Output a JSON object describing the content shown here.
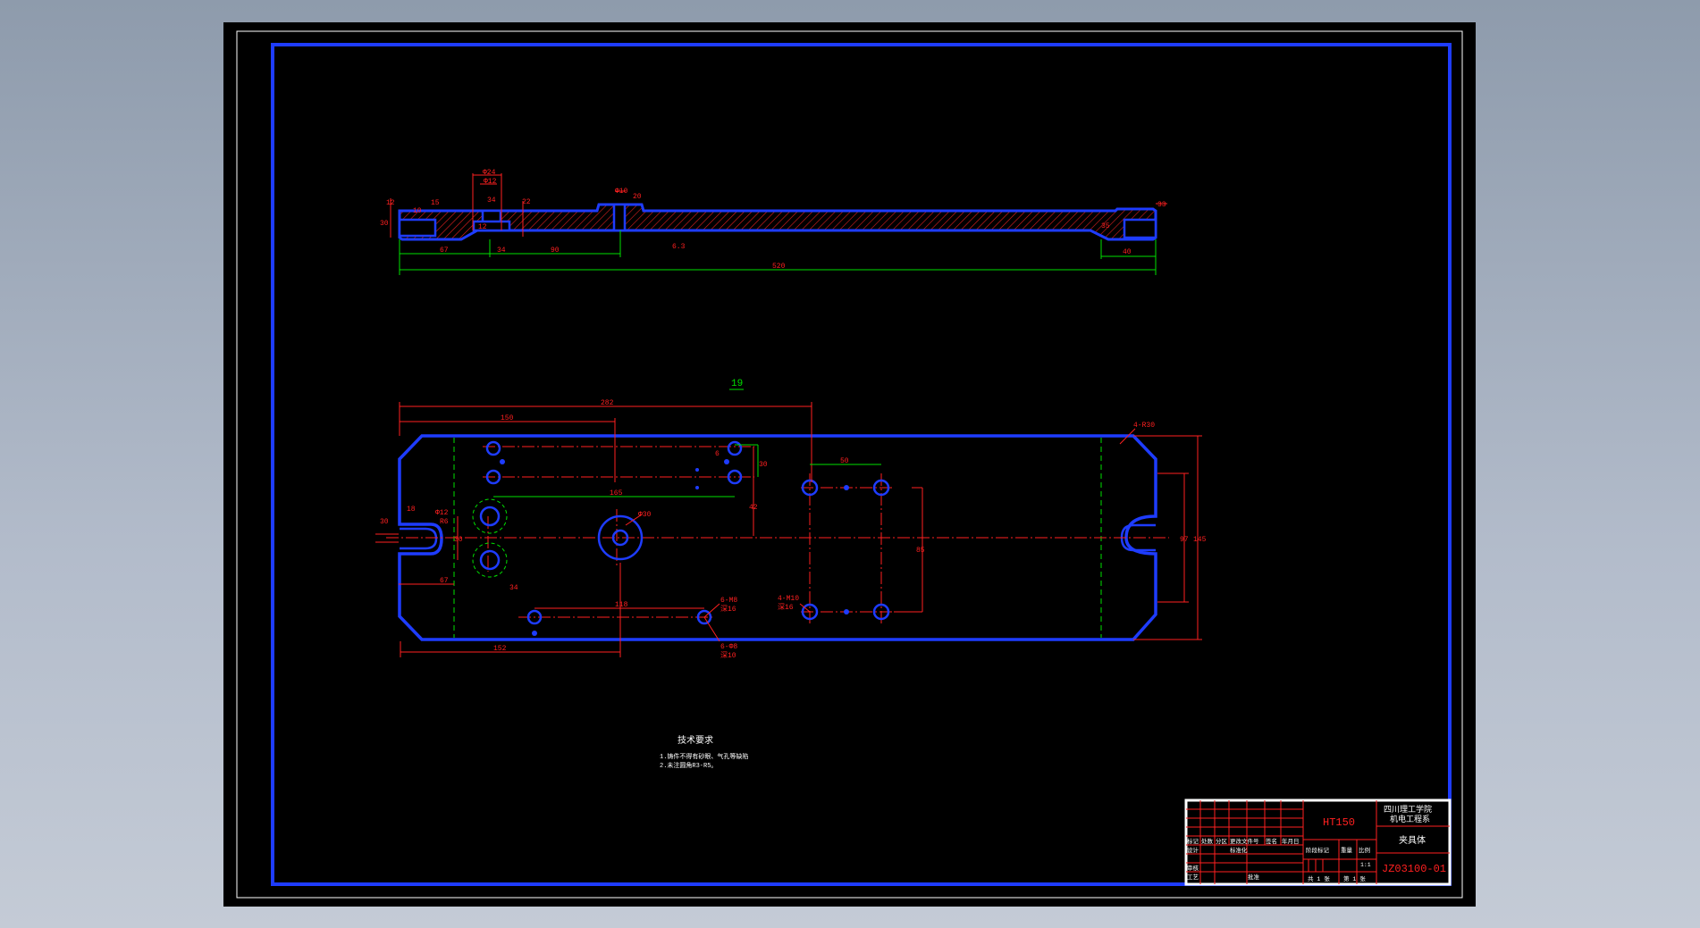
{
  "colors": {
    "background": "#9aa6b6",
    "paper": "#000000",
    "outline": "#1e3cff",
    "dimension": "#ff2020",
    "extension": "#00e000",
    "hatch": "#e02020",
    "frame": "#ffffff"
  },
  "section_view": {
    "dims_top": [
      "Φ24",
      "Φ12",
      "Φ10",
      "20",
      "34",
      "22",
      "33",
      "35"
    ],
    "dims_side": [
      "30",
      "12",
      "10",
      "15",
      "12"
    ],
    "dims_bottom": [
      "67",
      "34",
      "90",
      "40",
      "520"
    ],
    "roughness": "6.3"
  },
  "plan_view": {
    "datum_label": "19",
    "dims_top": [
      "282",
      "150",
      "50",
      "6",
      "30",
      "165"
    ],
    "dims_side": [
      "18",
      "Φ12",
      "R6",
      "30",
      "30",
      "67",
      "34",
      "42",
      "85",
      "97",
      "145"
    ],
    "dims_bottom": [
      "118",
      "152"
    ],
    "callouts": [
      "4-R30",
      "Φ30",
      "4-M10",
      "深16",
      "6-M8",
      "深16",
      "6-Φ8",
      "深10"
    ]
  },
  "notes": {
    "title": "技术要求",
    "lines": [
      "1.铸件不得有砂眼、气孔等缺陷",
      "2.未注圆角R3-R5。"
    ]
  },
  "title_block": {
    "material": "HT150",
    "school": "四川理工学院",
    "department": "机电工程系",
    "part_name": "夹具体",
    "drawing_no": "JZ03100-01",
    "header_cells": [
      "标记",
      "处数",
      "分区",
      "更改文件号",
      "签名",
      "年月日"
    ],
    "role_cells": [
      "设计",
      "标准化",
      "审核",
      "工艺",
      "批准"
    ],
    "stage_label": "阶段标记",
    "weight_label": "重量",
    "scale_label": "比例",
    "scale_value": "1:1",
    "sheet_total": "共 1 张",
    "sheet_no": "第 1 张"
  }
}
